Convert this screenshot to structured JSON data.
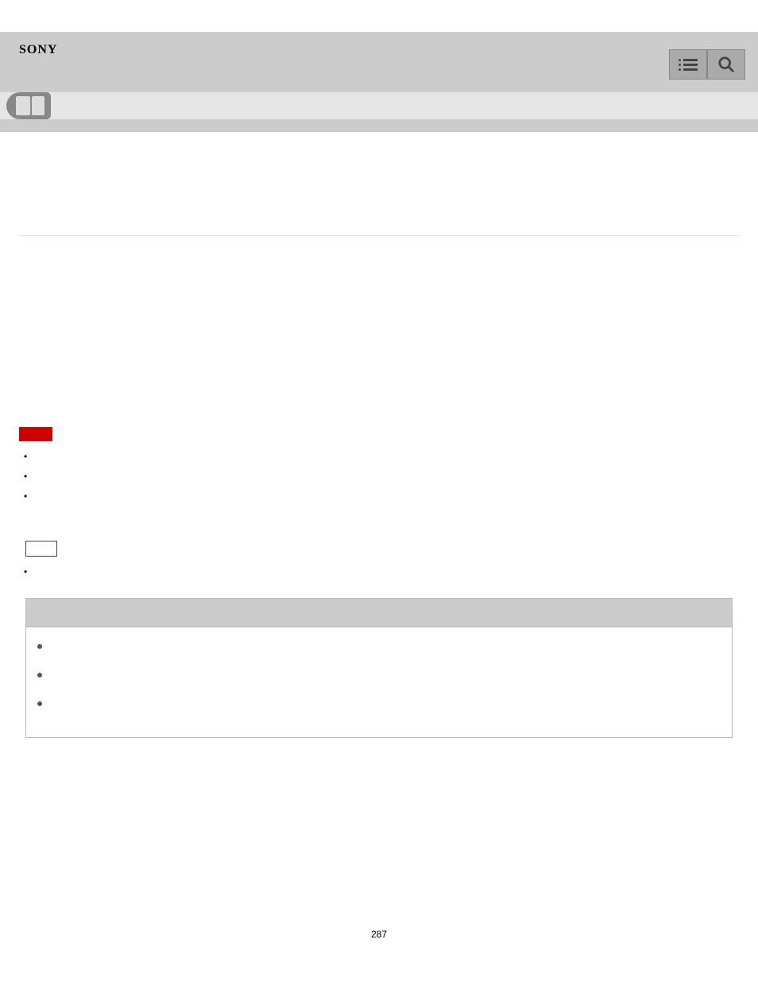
{
  "brand": "SONY",
  "page_number": "287",
  "content": {
    "bullets1": [
      "",
      "",
      ""
    ],
    "bullets2": [
      ""
    ],
    "table_bullets": [
      "",
      "",
      ""
    ]
  }
}
